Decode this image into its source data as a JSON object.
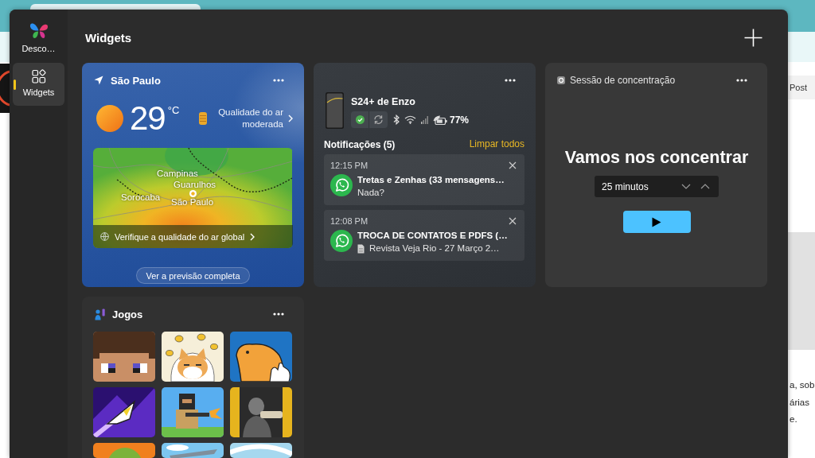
{
  "background_page": {
    "nav_text": "Post",
    "paragraph": [
      "a, sob",
      "árias",
      "e."
    ]
  },
  "sidebar": {
    "items": [
      {
        "kind": "app",
        "label": "Desco…",
        "selected": false
      },
      {
        "kind": "widgets",
        "label": "Widgets",
        "selected": true
      }
    ]
  },
  "header": {
    "title": "Widgets"
  },
  "weather": {
    "location": "São Paulo",
    "temperature": "29",
    "unit": "°C",
    "air_quality": "Qualidade do ar moderada",
    "map_labels": [
      "Campinas",
      "Guarulhos",
      "Sorocaba",
      "São Paulo"
    ],
    "map_link": "Verifique a qualidade do ar global",
    "forecast_button": "Ver a previsão completa"
  },
  "phone": {
    "device_name": "S24+ de Enzo",
    "connected": true,
    "battery": "77%",
    "notifications_title": "Notificações (5)",
    "clear_all": "Limpar todos",
    "notifications": [
      {
        "time": "12:15 PM",
        "title": "Tretas e Zenhas (33 mensagens…",
        "body": "Nada?",
        "attachment": false
      },
      {
        "time": "12:08 PM",
        "title": "TROCA DE CONTATOS E PDFS (…",
        "body": "Revista Veja Rio - 27 Março 2…",
        "attachment": true
      }
    ]
  },
  "focus": {
    "title": "Sessão de concentração",
    "heading": "Vamos nos concentrar",
    "duration": "25 minutos"
  },
  "games": {
    "title": "Jogos",
    "tiles": [
      {
        "kind": "blocky-face"
      },
      {
        "kind": "cartoon-dog"
      },
      {
        "kind": "capybara"
      },
      {
        "kind": "rocket"
      },
      {
        "kind": "blocky-soldier"
      },
      {
        "kind": "soldier"
      },
      {
        "kind": "green-creature"
      },
      {
        "kind": "airplane"
      },
      {
        "kind": "swoosh"
      }
    ]
  }
}
